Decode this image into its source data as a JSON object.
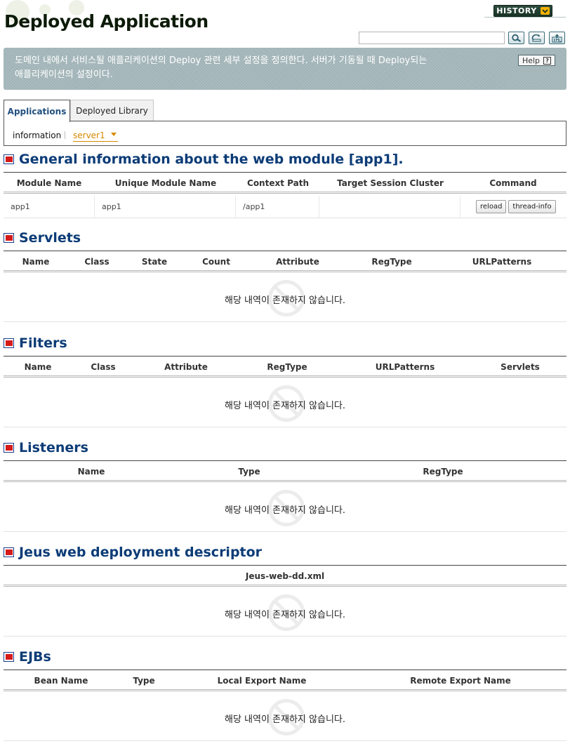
{
  "header": {
    "title": "Deployed Application",
    "history_label": "HISTORY",
    "search_value": ""
  },
  "banner": {
    "line1": "도메인 내에서 서비스될 애플리케이션의 Deploy 관련 세부 설정을 정의한다. 서버가 기동될 때 Deploy되는",
    "line2": "애플리케이션의 설정이다.",
    "help_label": "Help"
  },
  "tabs": [
    {
      "label": "Applications",
      "active": true
    },
    {
      "label": "Deployed Library",
      "active": false
    }
  ],
  "subnav": {
    "info_label": "information",
    "server_selected": "server1"
  },
  "empty_message": "해당 내역이 존재하지 않습니다.",
  "general": {
    "title": "General information about the web module [app1].",
    "columns": [
      "Module Name",
      "Unique Module Name",
      "Context Path",
      "Target Session Cluster",
      "Command"
    ],
    "row": {
      "module_name": "app1",
      "unique_module_name": "app1",
      "context_path": "/app1",
      "target_session_cluster": "",
      "commands": [
        "reload",
        "thread-info"
      ]
    }
  },
  "servlets": {
    "title": "Servlets",
    "columns": [
      "Name",
      "Class",
      "State",
      "Count",
      "Attribute",
      "RegType",
      "URLPatterns"
    ]
  },
  "filters": {
    "title": "Filters",
    "columns": [
      "Name",
      "Class",
      "Attribute",
      "RegType",
      "URLPatterns",
      "Servlets"
    ]
  },
  "listeners": {
    "title": "Listeners",
    "columns": [
      "Name",
      "Type",
      "RegType"
    ]
  },
  "jeus_dd": {
    "title": "Jeus web deployment descriptor",
    "columns": [
      "Jeus-web-dd.xml"
    ]
  },
  "ejbs": {
    "title": "EJBs",
    "columns": [
      "Bean Name",
      "Type",
      "Local Export Name",
      "Remote Export Name"
    ]
  },
  "colors": {
    "title_blue": "#0c3c77",
    "tab_active": "#21507f",
    "server_orange": "#d88800",
    "banner_bg": "#9fb2b6",
    "history_bg": "#1a3326"
  }
}
